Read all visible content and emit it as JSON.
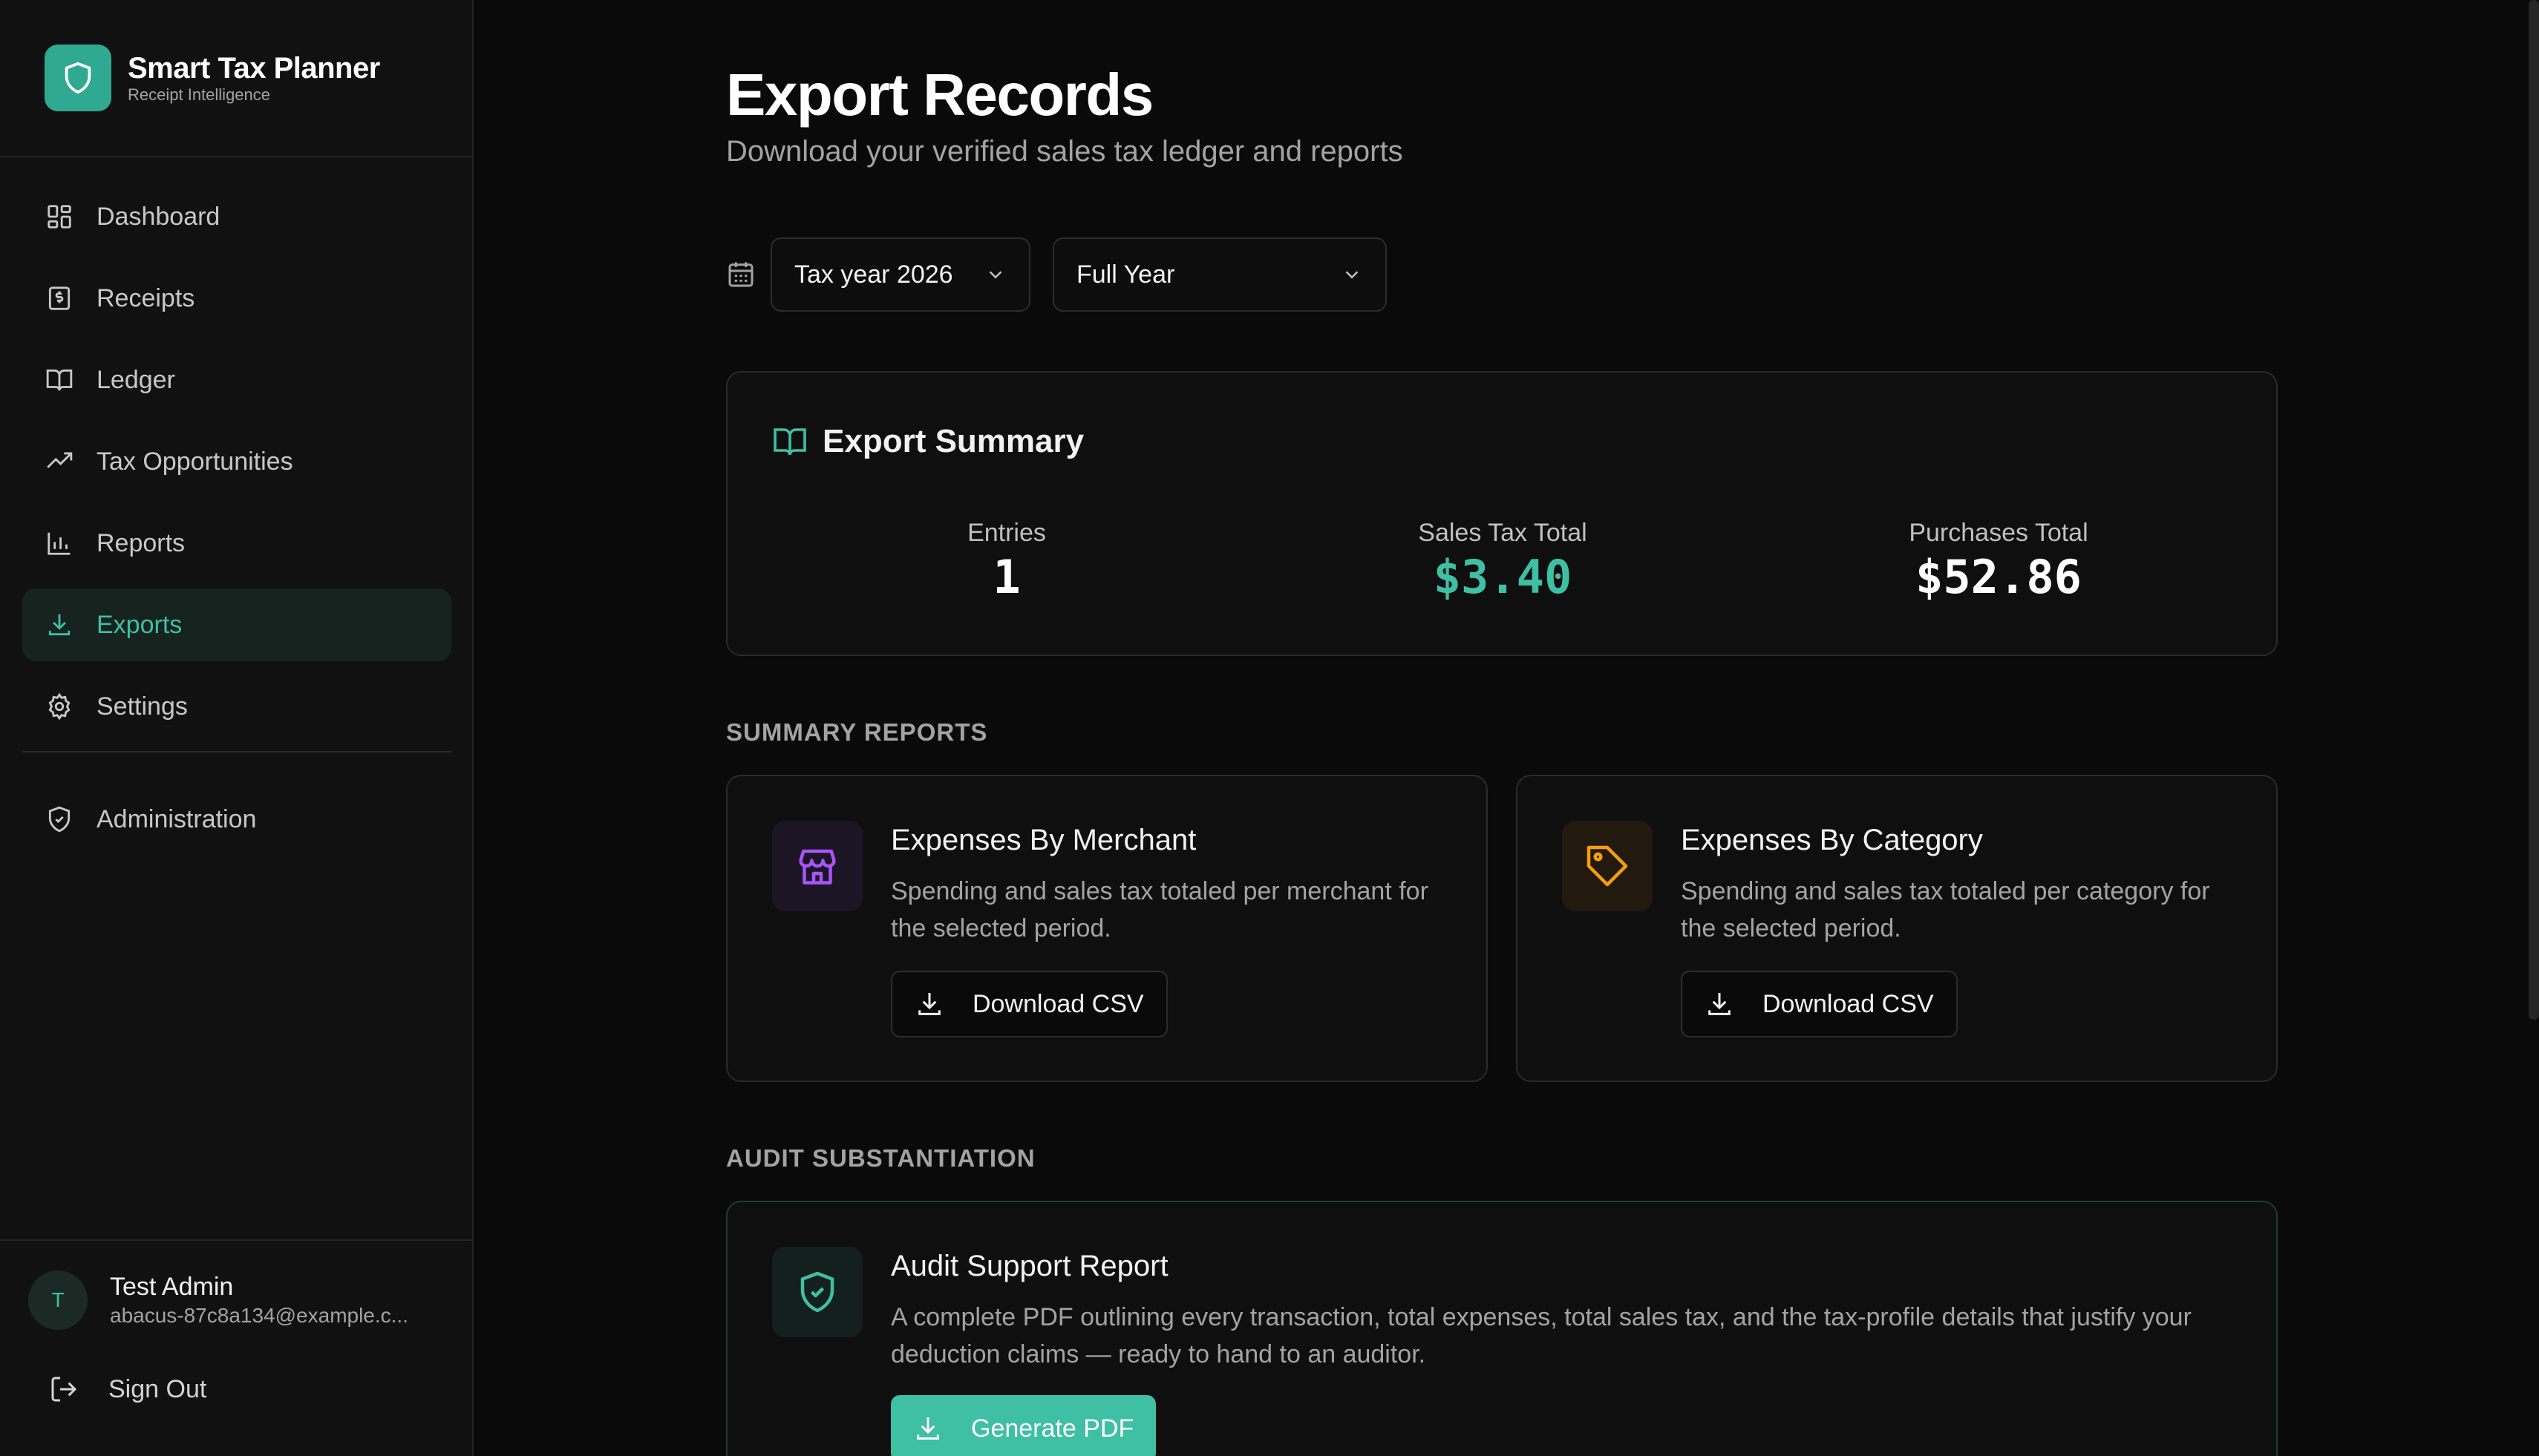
{
  "brand": {
    "title": "Smart Tax Planner",
    "subtitle": "Receipt Intelligence"
  },
  "nav": {
    "items": [
      {
        "label": "Dashboard",
        "icon": "grid-icon"
      },
      {
        "label": "Receipts",
        "icon": "receipt-icon"
      },
      {
        "label": "Ledger",
        "icon": "book-icon"
      },
      {
        "label": "Tax Opportunities",
        "icon": "trending-up-icon"
      },
      {
        "label": "Reports",
        "icon": "bar-chart-icon"
      },
      {
        "label": "Exports",
        "icon": "download-icon",
        "active": true
      },
      {
        "label": "Settings",
        "icon": "gear-icon"
      }
    ],
    "admin": {
      "label": "Administration",
      "icon": "shield-icon"
    }
  },
  "user": {
    "initial": "T",
    "name": "Test Admin",
    "email": "abacus-87c8a134@example.c..."
  },
  "signout": {
    "label": "Sign Out"
  },
  "page": {
    "title": "Export Records",
    "subtitle": "Download your verified sales tax ledger and reports"
  },
  "filters": {
    "year": "Tax year 2026",
    "period": "Full Year"
  },
  "summary": {
    "title": "Export Summary",
    "stats": [
      {
        "label": "Entries",
        "value": "1"
      },
      {
        "label": "Sales Tax Total",
        "value": "$3.40"
      },
      {
        "label": "Purchases Total",
        "value": "$52.86"
      }
    ]
  },
  "summary_reports": {
    "label": "SUMMARY REPORTS",
    "cards": [
      {
        "title": "Expenses By Merchant",
        "description": "Spending and sales tax totaled per merchant for the selected period.",
        "button": "Download CSV",
        "icon": "store-icon"
      },
      {
        "title": "Expenses By Category",
        "description": "Spending and sales tax totaled per category for the selected period.",
        "button": "Download CSV",
        "icon": "tag-icon"
      }
    ]
  },
  "audit": {
    "label": "AUDIT SUBSTANTIATION",
    "title": "Audit Support Report",
    "description": "A complete PDF outlining every transaction, total expenses, total sales tax, and the tax-profile details that justify your deduction claims — ready to hand to an auditor.",
    "button": "Generate PDF"
  },
  "colors": {
    "accent": "#3fbfa4",
    "background": "#0a0a0a",
    "purple": "#a855f7",
    "amber": "#f59e0b"
  }
}
